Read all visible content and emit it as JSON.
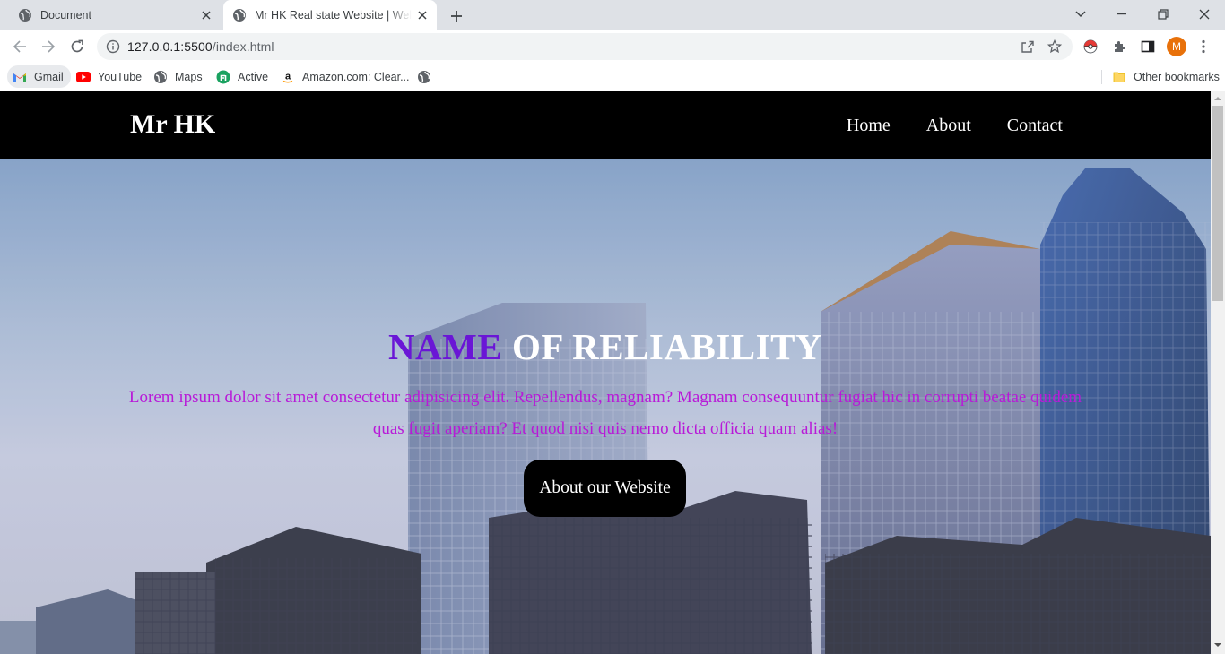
{
  "browser": {
    "tabs": [
      {
        "title": "Document",
        "active": false,
        "icon": "globe-icon"
      },
      {
        "title": "Mr HK Real state Website | Welcome",
        "active": true,
        "icon": "globe-icon"
      }
    ],
    "address": {
      "host": "127.0.0.1:5500",
      "path": "/index.html"
    },
    "profile_initial": "M",
    "bookmarks": [
      {
        "label": "Gmail",
        "icon": "gmail-icon"
      },
      {
        "label": "YouTube",
        "icon": "youtube-icon"
      },
      {
        "label": "Maps",
        "icon": "globe-icon"
      },
      {
        "label": "Active",
        "icon": "active-icon"
      },
      {
        "label": "Amazon.com: Clear...",
        "icon": "amazon-icon"
      }
    ],
    "other_bookmarks": "Other bookmarks"
  },
  "site": {
    "logo": "Mr HK",
    "nav": [
      "Home",
      "About",
      "Contact"
    ],
    "hero": {
      "title_accent": "NAME",
      "title_rest": " OF RELIABILITY",
      "text": "Lorem ipsum dolor sit amet consectetur adipisicing elit. Repellendus, magnam? Magnam consequuntur fugiat hic in corrupti beatae quidem quas fugit aperiam? Et quod nisi quis nemo dicta officia quam alias!",
      "button": "About our Website"
    }
  },
  "colors": {
    "accent_purple": "#6a16d6",
    "text_magenta": "#b81ad8",
    "header_bg": "#000000",
    "profile_orange": "#e8710a"
  }
}
